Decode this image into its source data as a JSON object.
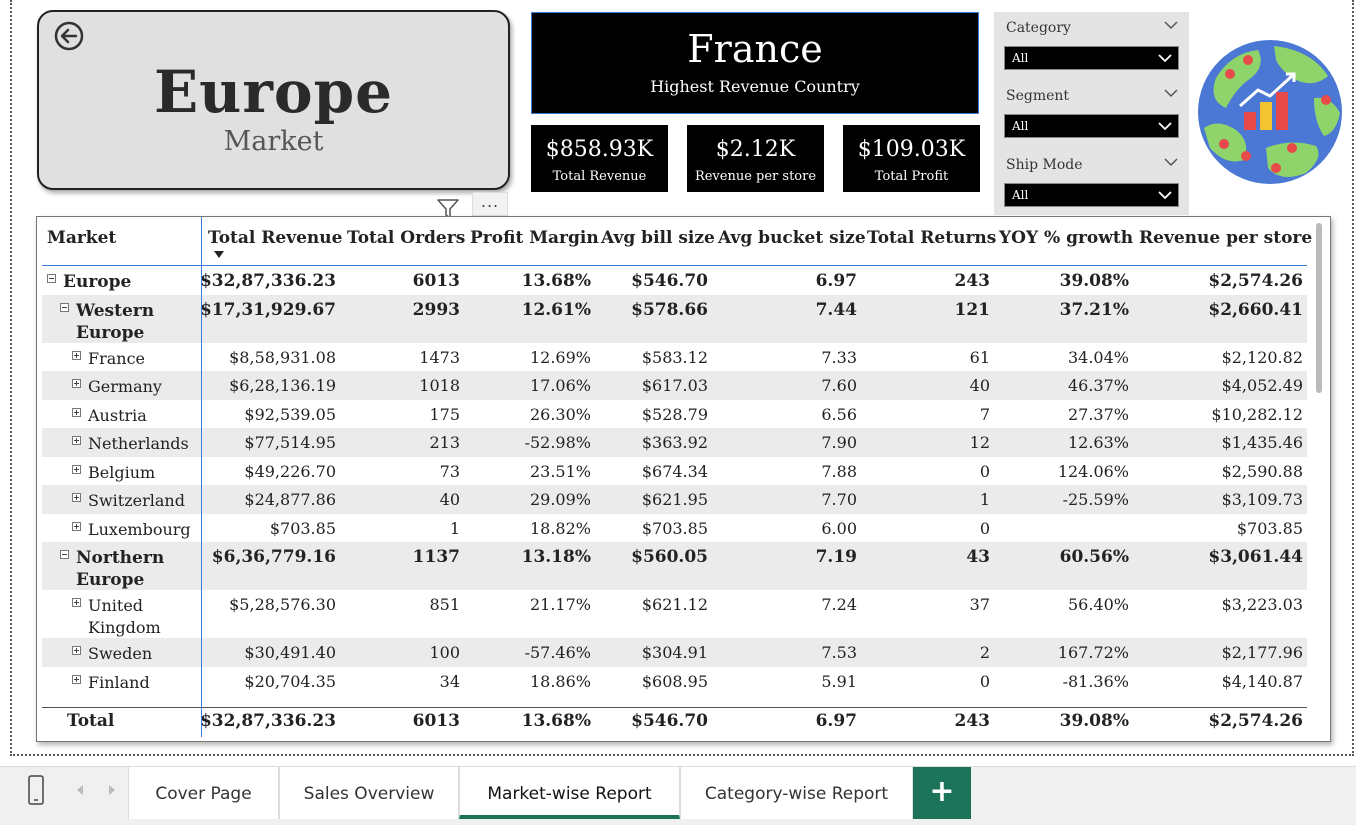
{
  "header": {
    "market_title": "Europe",
    "market_subtitle": "Market",
    "highest_country": "France",
    "highest_country_label": "Highest Revenue Country",
    "more_label": "..."
  },
  "kpis": [
    {
      "value": "$858.93K",
      "label": "Total Revenue"
    },
    {
      "value": "$2.12K",
      "label": "Revenue per store"
    },
    {
      "value": "$109.03K",
      "label": "Total Profit"
    }
  ],
  "slicers": [
    {
      "title": "Category",
      "value": "All"
    },
    {
      "title": "Segment",
      "value": "All"
    },
    {
      "title": "Ship Mode",
      "value": "All"
    }
  ],
  "table": {
    "columns": [
      "Market",
      "Total Revenue",
      "Total Orders",
      "Profit Margin",
      "Avg bill size",
      "Avg bucket size",
      "Total Returns",
      "YOY % growth",
      "Revenue per store"
    ],
    "rows": [
      {
        "level": 0,
        "name": [
          "Europe"
        ],
        "bold": true,
        "expander": "minus",
        "values": [
          "$32,87,336.23",
          "6013",
          "13.68%",
          "$546.70",
          "6.97",
          "243",
          "39.08%",
          "$2,574.26"
        ]
      },
      {
        "level": 1,
        "name": [
          "Western",
          "Europe"
        ],
        "bold": true,
        "expander": "minus",
        "values": [
          "$17,31,929.67",
          "2993",
          "12.61%",
          "$578.66",
          "7.44",
          "121",
          "37.21%",
          "$2,660.41"
        ]
      },
      {
        "level": 2,
        "name": [
          "France"
        ],
        "bold": false,
        "expander": "plus",
        "values": [
          "$8,58,931.08",
          "1473",
          "12.69%",
          "$583.12",
          "7.33",
          "61",
          "34.04%",
          "$2,120.82"
        ]
      },
      {
        "level": 2,
        "name": [
          "Germany"
        ],
        "bold": false,
        "expander": "plus",
        "values": [
          "$6,28,136.19",
          "1018",
          "17.06%",
          "$617.03",
          "7.60",
          "40",
          "46.37%",
          "$4,052.49"
        ]
      },
      {
        "level": 2,
        "name": [
          "Austria"
        ],
        "bold": false,
        "expander": "plus",
        "values": [
          "$92,539.05",
          "175",
          "26.30%",
          "$528.79",
          "6.56",
          "7",
          "27.37%",
          "$10,282.12"
        ]
      },
      {
        "level": 2,
        "name": [
          "Netherlands"
        ],
        "bold": false,
        "expander": "plus",
        "values": [
          "$77,514.95",
          "213",
          "-52.98%",
          "$363.92",
          "7.90",
          "12",
          "12.63%",
          "$1,435.46"
        ]
      },
      {
        "level": 2,
        "name": [
          "Belgium"
        ],
        "bold": false,
        "expander": "plus",
        "values": [
          "$49,226.70",
          "73",
          "23.51%",
          "$674.34",
          "7.88",
          "0",
          "124.06%",
          "$2,590.88"
        ]
      },
      {
        "level": 2,
        "name": [
          "Switzerland"
        ],
        "bold": false,
        "expander": "plus",
        "values": [
          "$24,877.86",
          "40",
          "29.09%",
          "$621.95",
          "7.70",
          "1",
          "-25.59%",
          "$3,109.73"
        ]
      },
      {
        "level": 2,
        "name": [
          "Luxembourg"
        ],
        "bold": false,
        "expander": "plus",
        "values": [
          "$703.85",
          "1",
          "18.82%",
          "$703.85",
          "6.00",
          "0",
          "",
          "$703.85"
        ]
      },
      {
        "level": 1,
        "name": [
          "Northern",
          "Europe"
        ],
        "bold": true,
        "expander": "minus",
        "values": [
          "$6,36,779.16",
          "1137",
          "13.18%",
          "$560.05",
          "7.19",
          "43",
          "60.56%",
          "$3,061.44"
        ]
      },
      {
        "level": 2,
        "name": [
          "United",
          "Kingdom"
        ],
        "bold": false,
        "expander": "plus",
        "values": [
          "$5,28,576.30",
          "851",
          "21.17%",
          "$621.12",
          "7.24",
          "37",
          "56.40%",
          "$3,223.03"
        ]
      },
      {
        "level": 2,
        "name": [
          "Sweden"
        ],
        "bold": false,
        "expander": "plus",
        "values": [
          "$30,491.40",
          "100",
          "-57.46%",
          "$304.91",
          "7.53",
          "2",
          "167.72%",
          "$2,177.96"
        ]
      },
      {
        "level": 2,
        "name": [
          "Finland"
        ],
        "bold": false,
        "expander": "plus",
        "values": [
          "$20,704.35",
          "34",
          "18.86%",
          "$608.95",
          "5.91",
          "0",
          "-81.36%",
          "$4,140.87"
        ]
      }
    ],
    "total": {
      "name": "Total",
      "values": [
        "$32,87,336.23",
        "6013",
        "13.68%",
        "$546.70",
        "6.97",
        "243",
        "39.08%",
        "$2,574.26"
      ]
    }
  },
  "tabs": [
    {
      "label": "Cover Page",
      "active": false
    },
    {
      "label": "Sales Overview",
      "active": false
    },
    {
      "label": "Market-wise Report",
      "active": true
    },
    {
      "label": "Category-wise Report",
      "active": false
    }
  ],
  "add_tab_label": "+",
  "colors": {
    "accent": "#1b7359",
    "header_bg": "#000000",
    "table_line": "#3a7bd5"
  }
}
